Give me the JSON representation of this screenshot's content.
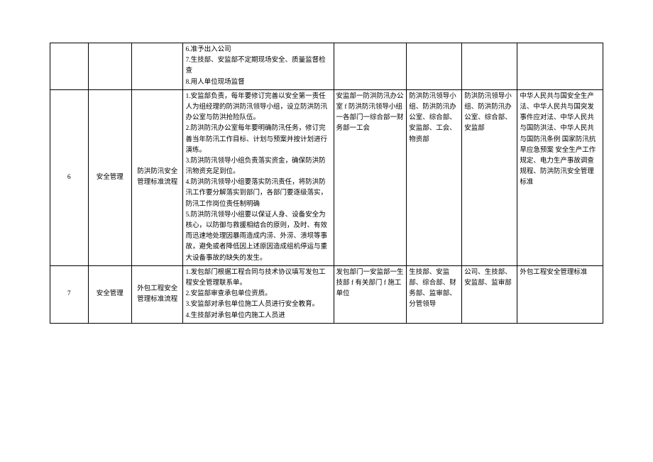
{
  "rows": [
    {
      "num": "",
      "category": "",
      "name": "",
      "steps": "6.准予出入公司\n7.生技部、安监部不定期现场安全、质量监督检查\n8.用人单位现场监督",
      "flow": "",
      "dept": "",
      "resp": "",
      "laws": ""
    },
    {
      "num": "6",
      "category": "安全管理",
      "name": "防洪防汛安全管理标准流程",
      "steps": "1.安监部负责，每年要修订完善以安全第一责任人为组经理的防洪防汛领导小组，设立防洪防汛办公室与防洪抢险队伍。\n2.防洪防汛办公室每年要明确防汛任务，修订完善当年防汛工作目标、计划与预案并按计划进行演练。\n3.防洪防汛领导小组负责落实资金，确保防洪防汛物资充足到位。\n4.防洪防汛领导小组要落实防汛责任，将防洪防汛工作要分解落实到部门，各部门要逐级落实，防汛工作岗位责任制明确\n5.防洪防汛领导小组要以保证人身、设备安全为核心，以防御与救援相结合的原则，及时、有效而迅速地处理因暴雨造成内涝、外涝、溃坝等事故，避免或者降低因上述原因造成组机停运与重大设备事故的缺失的发生。",
      "flow": "安监部一防洪防汛办公室 f 防洪防汛领导小组一各部门一综合部一财务部一工会",
      "dept": "防洪防汛领导小组、防洪防汛办公室、综合部、安监部、工会、物资部",
      "resp": "防洪防汛领导小组、防洪防汛办公室、综合部、安监部",
      "laws": "中华人民共与国安全生产法、中华人民共与国突发事件应对法、中华人民共与国防洪法、中华人民共与国防汛条例 国家防汛抗旱应急预案 安全生产工作规定、电力生产事故调查规程、防洪防汛安全管理标准"
    },
    {
      "num": "7",
      "category": "安全管理",
      "name": "外包工程安全管理标准流程",
      "steps": "1.发包部门根据工程合同与技术协议填写发包工程安全管理联系单。\n2.安监部审查承包单位资质。\n3.安监部对承包单位施工人员进行安全教育。\n4.生技部对承包单位内施工人员进",
      "flow": "发包部门一安监部一生技部 f 有关部门 f 施工单位",
      "dept": "生技部、安监部、综合部、财务部、监审部、分管领导",
      "resp": "公司、生技部、安监部、监审部",
      "laws": "外包工程安全管理标准"
    }
  ]
}
